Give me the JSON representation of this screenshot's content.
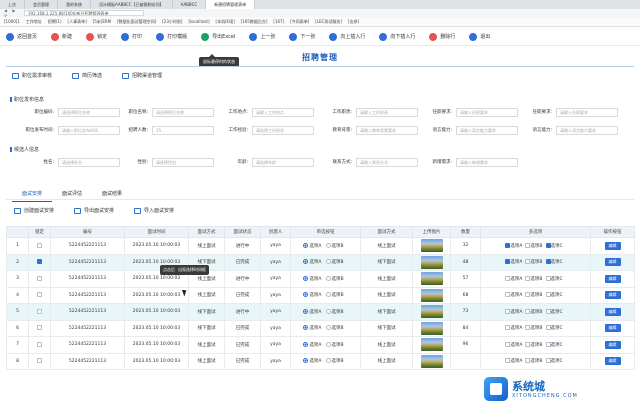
{
  "browser": {
    "tabs": [
      "上次",
      "会员管理",
      "我的系统",
      "设计模板AABBCC【已被限制访问】",
      "AABBCC",
      "新建招聘管理表单"
    ],
    "url": "192.168.1.225:88/1000/新开招聘管理表单",
    "bookmarks": [
      "[1000]1",
      "工作地址",
      "招聘(1)",
      "[人事表单]",
      "[5米]ERM",
      "[数据化面试管理空间]",
      "[23小时前]",
      "[localhost]",
      "[本机环境]",
      "[165数据后台]",
      "[167]",
      "[今同表单]",
      "[LEC测试服务]",
      "[出参]"
    ]
  },
  "toolbar": {
    "buttons": [
      {
        "label": "返回首页",
        "icon": "home-icon",
        "color": "#2d6fd6"
      },
      {
        "label": "新建",
        "icon": "new-icon",
        "color": "#e55353"
      },
      {
        "label": "锁定",
        "icon": "lock-icon",
        "color": "#e55353"
      },
      {
        "label": "打印",
        "icon": "print-icon",
        "color": "#2d6fd6"
      },
      {
        "label": "打印模版",
        "icon": "print-template-icon",
        "color": "#2d6fd6"
      },
      {
        "label": "导出Excel",
        "icon": "excel-icon",
        "color": "#1aa260"
      },
      {
        "label": "上一张",
        "icon": "prev-icon",
        "color": "#2d6fd6"
      },
      {
        "label": "下一张",
        "icon": "next-icon",
        "color": "#2d6fd6"
      },
      {
        "label": "向上插入行",
        "icon": "insert-up-icon",
        "color": "#2d6fd6"
      },
      {
        "label": "向下插入行",
        "icon": "insert-down-icon",
        "color": "#2d6fd6"
      },
      {
        "label": "删除行",
        "icon": "delete-row-icon",
        "color": "#e55353"
      },
      {
        "label": "退出",
        "icon": "exit-icon",
        "color": "#2d6fd6"
      }
    ],
    "tooltip": "鼠标悬停时的状态"
  },
  "page": {
    "title": "招聘管理"
  },
  "subtabs": [
    "职位需求审核",
    "简历筛选",
    "招聘渠道管理"
  ],
  "position_section": {
    "title": "职位发布信息",
    "row1": [
      {
        "label": "职位编码:",
        "placeholder": "请选择职位名称"
      },
      {
        "label": "职位名称:",
        "placeholder": "请选择职位名称"
      },
      {
        "label": "工作地点:",
        "placeholder": "请输入工作地点"
      },
      {
        "label": "工作职责:",
        "placeholder": "请输入工作职责"
      },
      {
        "label": "任职要求:",
        "placeholder": "请输入任职要求"
      },
      {
        "label": "任职要求:",
        "placeholder": "请输入任职要求"
      }
    ],
    "row2": [
      {
        "label": "职位发布时间:",
        "placeholder": "请输入职位发布时间"
      },
      {
        "label": "招聘人数:",
        "placeholder": "25"
      },
      {
        "label": "工作经验:",
        "placeholder": "请选择工作经验"
      },
      {
        "label": "教育背景:",
        "placeholder": "请输入教育背景要求"
      },
      {
        "label": "语言能力:",
        "placeholder": "请输入语言能力要求"
      },
      {
        "label": "语言能力:",
        "placeholder": "请输入语言能力要求"
      }
    ]
  },
  "candidate_section": {
    "title": "候选人信息",
    "row": [
      {
        "label": "姓名:",
        "placeholder": "请选择姓名"
      },
      {
        "label": "性别:",
        "placeholder": "请选择性别"
      },
      {
        "label": "年龄:",
        "placeholder": "请选择年龄"
      },
      {
        "label": "联系方式:",
        "placeholder": "请输入联系方式"
      },
      {
        "label": "新增需求:",
        "placeholder": "请输入新增需求"
      }
    ]
  },
  "result_tabs": [
    "面试安排",
    "面试评估",
    "面试结果"
  ],
  "actions": [
    "创建面试安排",
    "导出面试安排",
    "导入面试安排"
  ],
  "table": {
    "headers": [
      "",
      "锁定",
      "编号",
      "面试时间",
      "面试方式",
      "面试状态",
      "创建人",
      "单选按钮",
      "面试方式",
      "上传图片",
      "数量",
      "多选项",
      "操作按钮"
    ],
    "options_radio": [
      "选项A",
      "选项B"
    ],
    "options_check": [
      "选项A",
      "选项B",
      "选项C"
    ],
    "edit_label": "编辑",
    "rows": [
      {
        "n": "1",
        "locked": false,
        "code": "5224452221113",
        "time": "2023.05.10 10:00:03",
        "mode": "线上面试",
        "status": "进行中",
        "creator": "yaya",
        "radio": "A",
        "mode2": "线上面试",
        "qty": "32",
        "checks": [
          true,
          false,
          true
        ]
      },
      {
        "n": "2",
        "locked": true,
        "code": "5224452221113",
        "time": "2023.05.10 10:00:03",
        "mode": "线下面试",
        "status": "已完成",
        "creator": "yaya",
        "radio": "A",
        "mode2": "线下面试",
        "qty": "48",
        "checks": [
          true,
          false,
          true
        ]
      },
      {
        "n": "3",
        "locked": false,
        "code": "5224452221113",
        "time": "2023.05.10 10:00:03",
        "mode": "线上面试",
        "status": "进行中",
        "creator": "yaya",
        "radio": "A",
        "mode2": "线上面试",
        "qty": "57",
        "checks": [
          false,
          false,
          false
        ]
      },
      {
        "n": "4",
        "locked": false,
        "code": "5224452221113",
        "time": "2023.05.10 10:00:03",
        "mode": "线上面试",
        "status": "已完成",
        "creator": "yaya",
        "radio": "A",
        "mode2": "线上面试",
        "qty": "68",
        "checks": [
          false,
          false,
          false
        ]
      },
      {
        "n": "5",
        "locked": false,
        "code": "5224452221113",
        "time": "2023.05.10 10:00:03",
        "mode": "线下面试",
        "status": "进行中",
        "creator": "yaya",
        "radio": "A",
        "mode2": "线下面试",
        "qty": "73",
        "checks": [
          false,
          false,
          false
        ]
      },
      {
        "n": "6",
        "locked": false,
        "code": "5224452221113",
        "time": "2023.05.10 10:00:03",
        "mode": "线下面试",
        "status": "已完成",
        "creator": "yaya",
        "radio": "A",
        "mode2": "线下面试",
        "qty": "84",
        "checks": [
          false,
          false,
          false
        ]
      },
      {
        "n": "7",
        "locked": false,
        "code": "5224452221113",
        "time": "2023.05.10 10:00:03",
        "mode": "线上面试",
        "status": "已完成",
        "creator": "yaya",
        "radio": "A",
        "mode2": "线上面试",
        "qty": "96",
        "checks": [
          false,
          false,
          false
        ]
      },
      {
        "n": "8",
        "locked": false,
        "code": "5224452221113",
        "time": "2023.05.10 10:00:03",
        "mode": "线上面试",
        "status": "已完成",
        "creator": "yaya",
        "radio": "A",
        "mode2": "线上面试",
        "qty": "",
        "checks": [
          false,
          false,
          false
        ]
      }
    ],
    "hover_tip": [
      "点击后",
      "出现选择时间框"
    ]
  },
  "watermark": {
    "title": "系统城",
    "sub": "XITONGCHENG.COM"
  }
}
